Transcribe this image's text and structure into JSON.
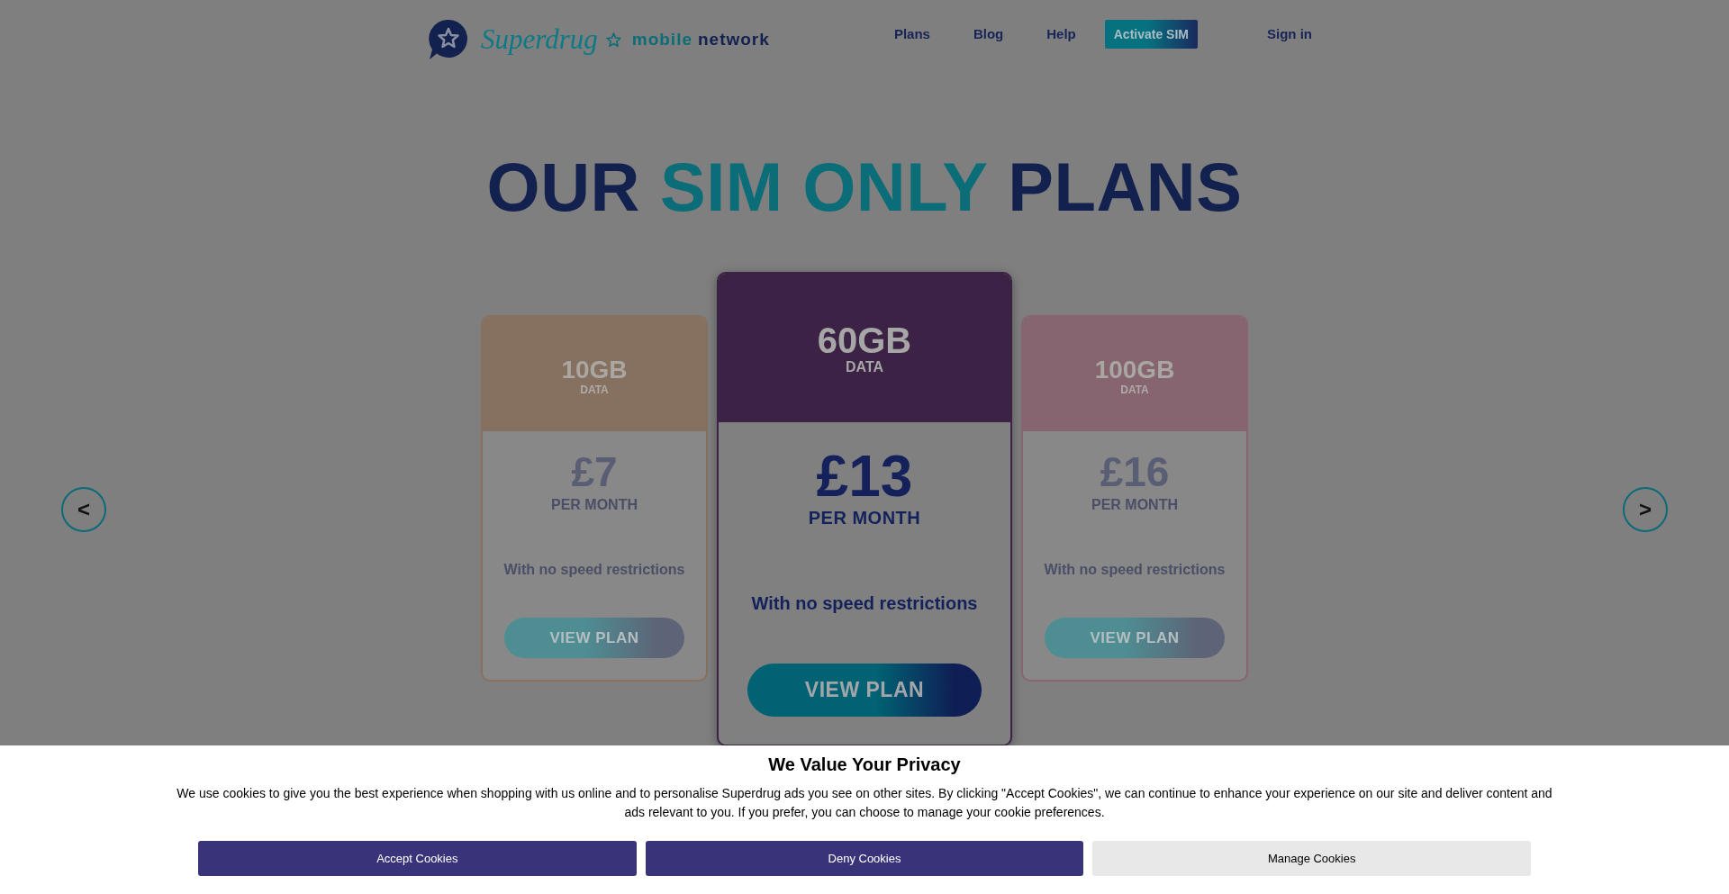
{
  "header": {
    "logo": {
      "wordmark": "Superdrug",
      "words": [
        {
          "text": "mobile",
          "highlight": true
        },
        {
          "text": "network",
          "highlight": false
        }
      ]
    },
    "nav": [
      {
        "label": "Plans",
        "kind": "link"
      },
      {
        "label": "Blog",
        "kind": "link"
      },
      {
        "label": "Help",
        "kind": "link"
      },
      {
        "label": "Activate SIM",
        "kind": "button"
      },
      {
        "label": "Sign in",
        "kind": "link"
      }
    ]
  },
  "hero": {
    "title": [
      {
        "text": "OUR",
        "highlight": false
      },
      {
        "text": "SIM ONLY",
        "highlight": true
      },
      {
        "text": "PLANS",
        "highlight": false
      }
    ]
  },
  "carousel": {
    "prev": "<",
    "next": ">",
    "plans": [
      {
        "data": "10GB",
        "data_label": "DATA",
        "price": "£7",
        "period": "PER MONTH",
        "feature": "With no speed restrictions",
        "button": "VIEW PLAN",
        "selected": false,
        "color": "#86705f"
      },
      {
        "data": "60GB",
        "data_label": "DATA",
        "price": "£13",
        "period": "PER MONTH",
        "feature": "With no speed restrictions",
        "button": "VIEW PLAN",
        "selected": true,
        "color": "#3c2244"
      },
      {
        "data": "100GB",
        "data_label": "DATA",
        "price": "£16",
        "period": "PER MONTH",
        "feature": "With no speed restrictions",
        "button": "VIEW PLAN",
        "selected": false,
        "color": "#866470"
      }
    ]
  },
  "cookie_banner": {
    "title": "We Value Your Privacy",
    "text": "We use cookies to give you the best experience when shopping with us online and to personalise Superdrug ads you see on other sites. By clicking \"Accept Cookies\", we can continue to enhance your experience on our site and deliver content and ads relevant to you. If you prefer, you can choose to manage your cookie preferences.",
    "buttons": [
      {
        "label": "Accept Cookies",
        "kind": "primary"
      },
      {
        "label": "Deny Cookies",
        "kind": "primary"
      },
      {
        "label": "Manage Cookies",
        "kind": "secondary"
      }
    ]
  }
}
